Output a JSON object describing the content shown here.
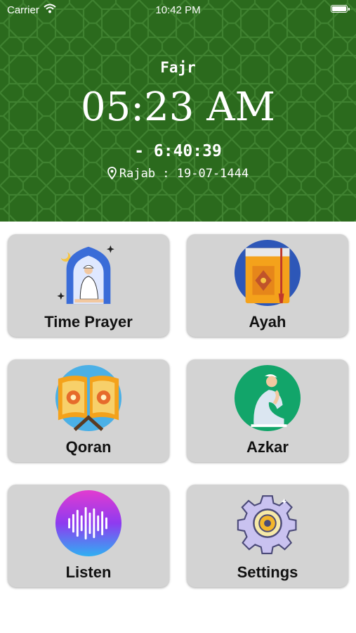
{
  "status_bar": {
    "carrier": "Carrier",
    "time": "10:42 PM"
  },
  "header": {
    "prayer_name": "Fajr",
    "prayer_time": "05:23 AM",
    "countdown": "- 6:40:39",
    "hijri_date": "Rajab : 19-07-1444"
  },
  "menu": {
    "time_prayer": "Time Prayer",
    "ayah": "Ayah",
    "qoran": "Qoran",
    "azkar": "Azkar",
    "listen": "Listen",
    "settings": "Settings"
  },
  "colors": {
    "header_bg": "#2b6a1d",
    "card_bg": "#d3d3d3"
  },
  "icons": [
    "mosque-prayer-icon",
    "quran-book-icon",
    "open-quran-icon",
    "praying-man-icon",
    "audio-wave-icon",
    "gear-icon"
  ]
}
